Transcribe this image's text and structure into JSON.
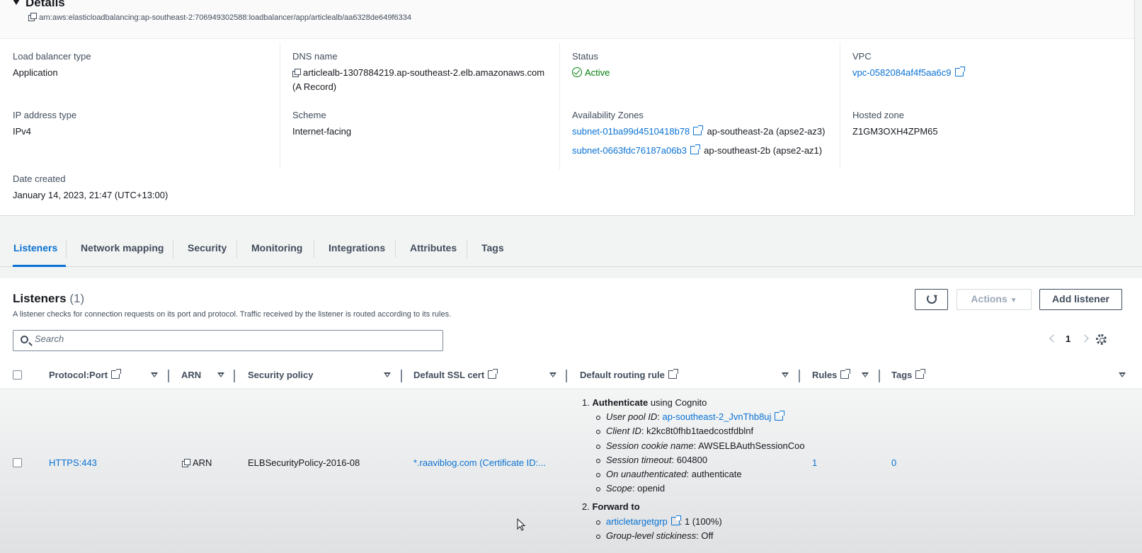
{
  "details": {
    "title": "Details",
    "arn": "arn:aws:elasticloadbalancing:ap-southeast-2:706949302588:loadbalancer/app/articlealb/aa6328de649f6334",
    "fields": {
      "lb_type_label": "Load balancer type",
      "lb_type_value": "Application",
      "dns_label": "DNS name",
      "dns_value": "articlealb-1307884219.ap-southeast-2.elb.amazonaws.com",
      "dns_record": "(A Record)",
      "status_label": "Status",
      "status_value": "Active",
      "vpc_label": "VPC",
      "vpc_value": "vpc-0582084af4f5aa6c9",
      "ip_type_label": "IP address type",
      "ip_type_value": "IPv4",
      "scheme_label": "Scheme",
      "scheme_value": "Internet-facing",
      "az_label": "Availability Zones",
      "az": [
        {
          "subnet": "subnet-01ba99d4510418b78",
          "zone": "ap-southeast-2a (apse2-az3)"
        },
        {
          "subnet": "subnet-0663fdc76187a06b3",
          "zone": "ap-southeast-2b (apse2-az1)"
        }
      ],
      "hosted_zone_label": "Hosted zone",
      "hosted_zone_value": "Z1GM3OXH4ZPM65",
      "date_label": "Date created",
      "date_value": "January 14, 2023, 21:47 (UTC+13:00)"
    }
  },
  "tabs": [
    "Listeners",
    "Network mapping",
    "Security",
    "Monitoring",
    "Integrations",
    "Attributes",
    "Tags"
  ],
  "listeners": {
    "title": "Listeners",
    "count": "(1)",
    "description": "A listener checks for connection requests on its port and protocol. Traffic received by the listener is routed according to its rules.",
    "actions_label": "Actions",
    "add_label": "Add listener",
    "search_placeholder": "Search",
    "page": "1",
    "columns": [
      "Protocol:Port",
      "ARN",
      "Security policy",
      "Default SSL cert",
      "Default routing rule",
      "Rules",
      "Tags"
    ],
    "row": {
      "protocol_port": "HTTPS:443",
      "arn": "ARN",
      "security_policy": "ELBSecurityPolicy-2016-08",
      "ssl_cert": "*.raaviblog.com (Certificate ID:...",
      "rules": "1",
      "tags": "0",
      "routing": {
        "r1_num": "1.",
        "r1_action": "Authenticate",
        "r1_suffix": " using Cognito",
        "user_pool_label": "User pool ID",
        "user_pool_value": "ap-southeast-2_JvnThb8uj",
        "client_label": "Client ID",
        "client_value": "k2kc8t0fhb1taedcostfdblnf",
        "cookie_label": "Session cookie name",
        "cookie_value": "AWSELBAuthSessionCoo",
        "timeout_label": "Session timeout",
        "timeout_value": "604800",
        "unauth_label": "On unauthenticated",
        "unauth_value": "authenticate",
        "scope_label": "Scope",
        "scope_value": "openid",
        "r2_num": "2.",
        "r2_action": "Forward to",
        "tg_name": "articletargetgrp",
        "tg_weight": ": 1 (100%)",
        "stick_label": "Group-level stickiness",
        "stick_value": "Off"
      }
    }
  }
}
